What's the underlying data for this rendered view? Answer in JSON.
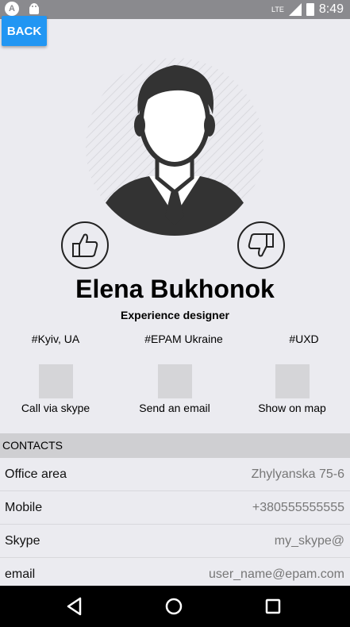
{
  "status_bar": {
    "time": "8:49",
    "network": "LTE",
    "icons": [
      "app-a-icon",
      "android-icon",
      "signal-icon",
      "battery-icon"
    ]
  },
  "back_button": {
    "label": "BACK"
  },
  "profile": {
    "name": "Elena Bukhonok",
    "title": "Experience designer"
  },
  "tags": [
    "#Kyiv, UA",
    "#EPAM Ukraine",
    "#UXD"
  ],
  "actions": [
    {
      "label": "Call via skype"
    },
    {
      "label": "Send an email"
    },
    {
      "label": "Show on map"
    }
  ],
  "contacts": {
    "header": "CONTACTS",
    "rows": [
      {
        "key": "Office area",
        "value": "Zhylyanska 75-6"
      },
      {
        "key": "Mobile",
        "value": "+380555555555"
      },
      {
        "key": "Skype",
        "value": "my_skype@"
      },
      {
        "key": "email",
        "value": "user_name@epam.com"
      }
    ]
  },
  "colors": {
    "accent": "#2196f3",
    "background": "#ebebf0",
    "section_header": "#cfcfd2"
  }
}
